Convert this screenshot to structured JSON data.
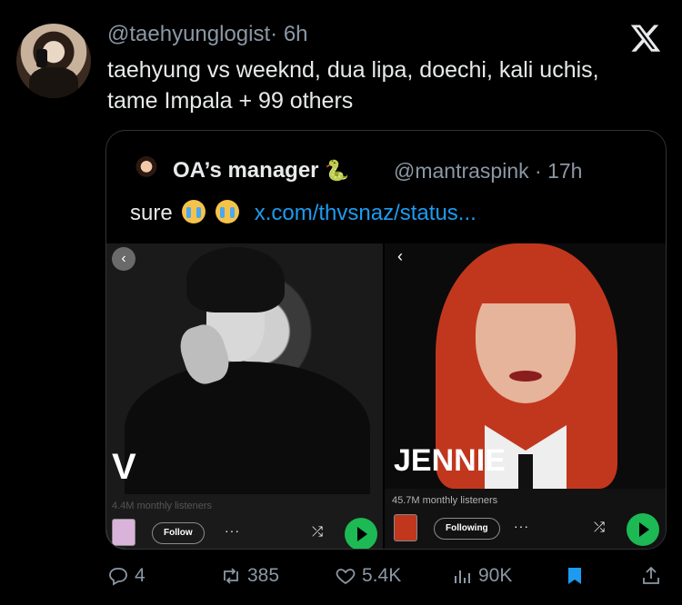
{
  "tweet": {
    "handle": "@taehyunglogist",
    "time": "· 6h",
    "text": "taehyung vs weeknd, dua lipa, doechi, kali uchis, tame Impala + 99 others"
  },
  "quote": {
    "name": "OA’s manager",
    "handle": "@mantraspink · 17h",
    "text": "sure",
    "link": "x.com/thvsnaz/status..."
  },
  "artists": [
    {
      "name": "V",
      "listeners": "4.4M monthly listeners",
      "follow_label": "Follow"
    },
    {
      "name": "JENNIE",
      "listeners": "45.7M monthly listeners",
      "follow_label": "Following"
    }
  ],
  "actions": {
    "replies": "4",
    "reposts": "385",
    "likes": "5.4K",
    "views": "90K"
  },
  "colors": {
    "accent": "#1d9bf0",
    "muted": "#8b98a5",
    "spotify_green": "#1db954"
  }
}
